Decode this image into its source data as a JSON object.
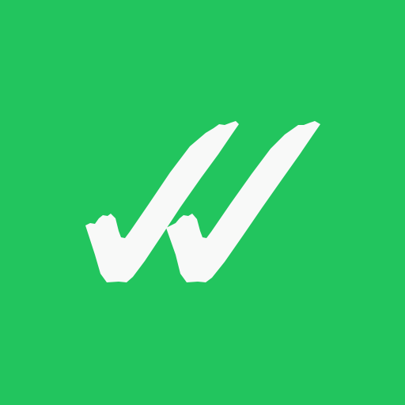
{
  "icon": {
    "name": "double-check-icon",
    "background_color": "#22C55E",
    "mark_color": "#F8F9F8"
  }
}
